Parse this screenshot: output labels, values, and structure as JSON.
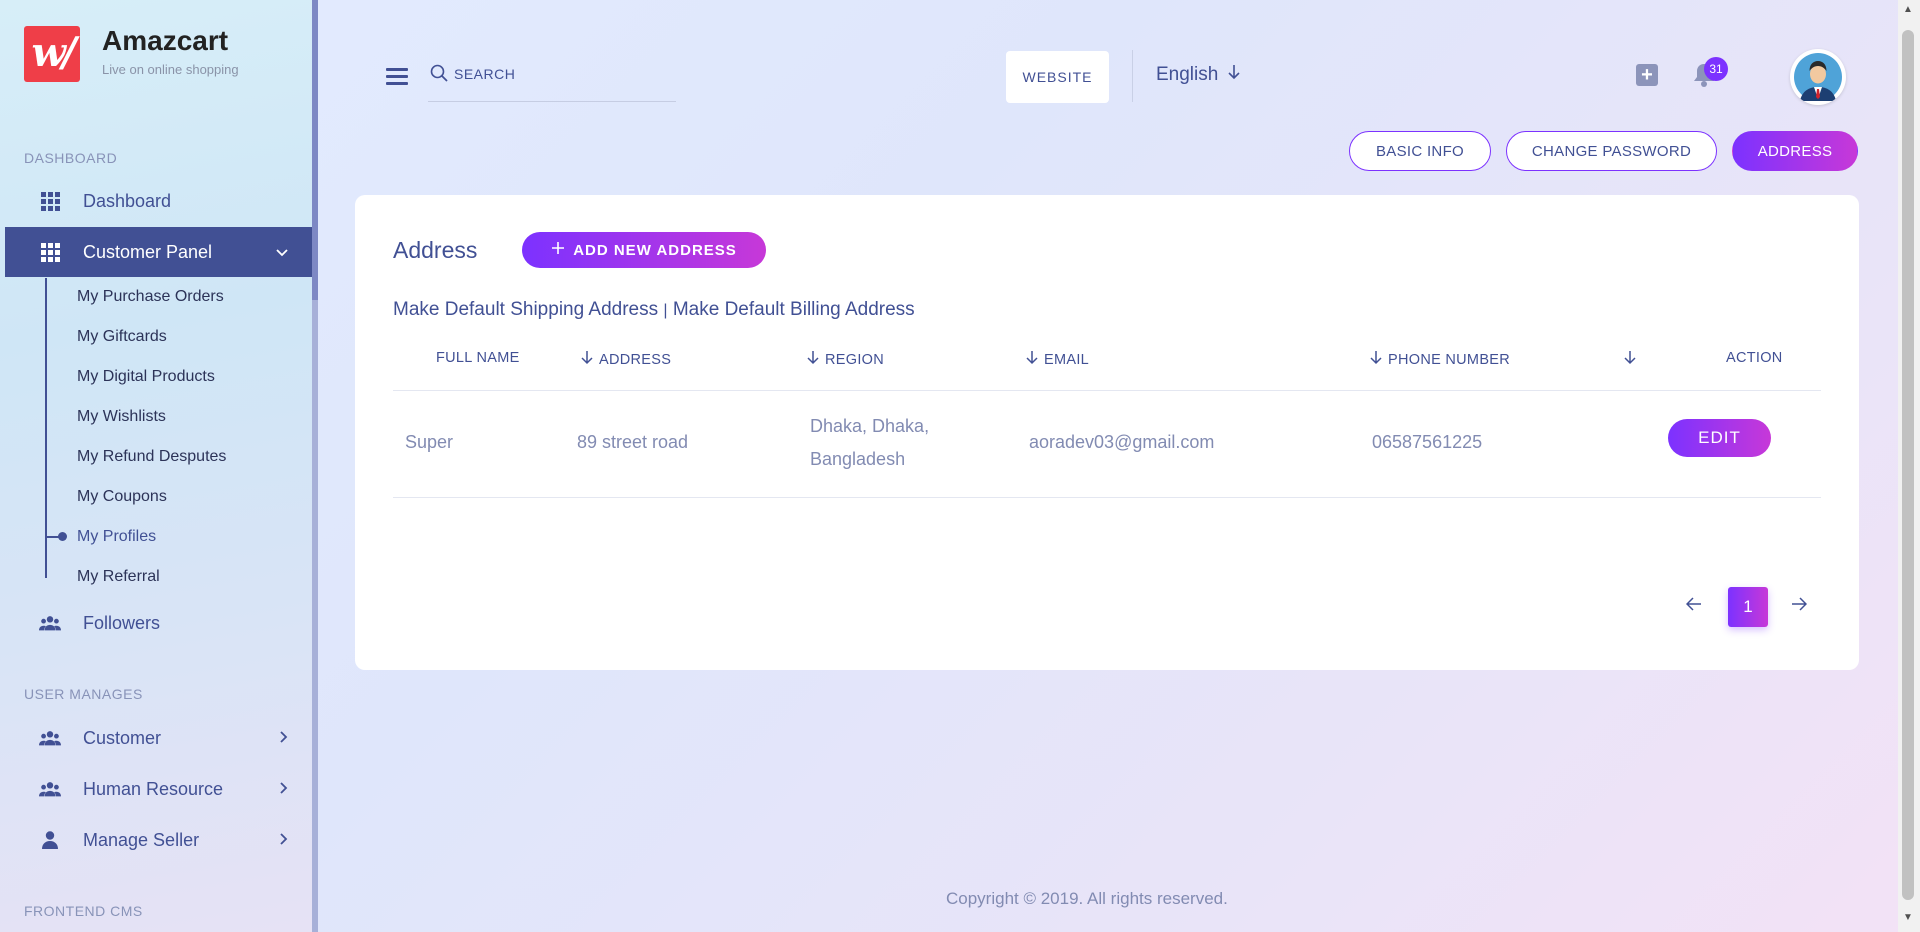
{
  "brand": {
    "name": "Amazcart",
    "tagline": "Live on online shopping",
    "logo_glyph": "w/"
  },
  "sidebar": {
    "section_dashboard": "DASHBOARD",
    "dashboard": "Dashboard",
    "customer_panel": "Customer Panel",
    "sub_items": [
      "My Purchase Orders",
      "My Giftcards",
      "My Digital Products",
      "My Wishlists",
      "My Refund Desputes",
      "My Coupons",
      "My Profiles",
      "My Referral"
    ],
    "followers": "Followers",
    "section_user_manages": "USER MANAGES",
    "customer": "Customer",
    "human_resource": "Human Resource",
    "manage_seller": "Manage Seller",
    "section_frontend_cms": "FRONTEND CMS"
  },
  "header": {
    "search_placeholder": "SEARCH",
    "website_label": "WEBSITE",
    "language": "English",
    "notification_count": "31"
  },
  "profile_tabs": {
    "basic_info": "BASIC INFO",
    "change_password": "CHANGE PASSWORD",
    "address": "ADDRESS"
  },
  "address_card": {
    "title": "Address",
    "add_button": "ADD NEW ADDRESS",
    "default_shipping": "Make Default Shipping Address",
    "separator": "|",
    "default_billing": "Make Default Billing Address",
    "columns": {
      "full_name": "FULL NAME",
      "address": "ADDRESS",
      "region": "REGION",
      "email": "EMAIL",
      "phone": "PHONE NUMBER",
      "action": "ACTION"
    },
    "rows": [
      {
        "full_name": "Super",
        "address": "89 street road",
        "region_line1": "Dhaka, Dhaka,",
        "region_line2": "Bangladesh",
        "email": "aoradev03@gmail.com",
        "phone": "06587561225",
        "action": "EDIT"
      }
    ],
    "pagination": {
      "current": "1",
      "prev": "←",
      "next": "→"
    }
  },
  "footer": "Copyright © 2019. All rights reserved.",
  "colors": {
    "primary": "#415094",
    "accent": "#7c32ff",
    "accent2": "#c738d8"
  }
}
